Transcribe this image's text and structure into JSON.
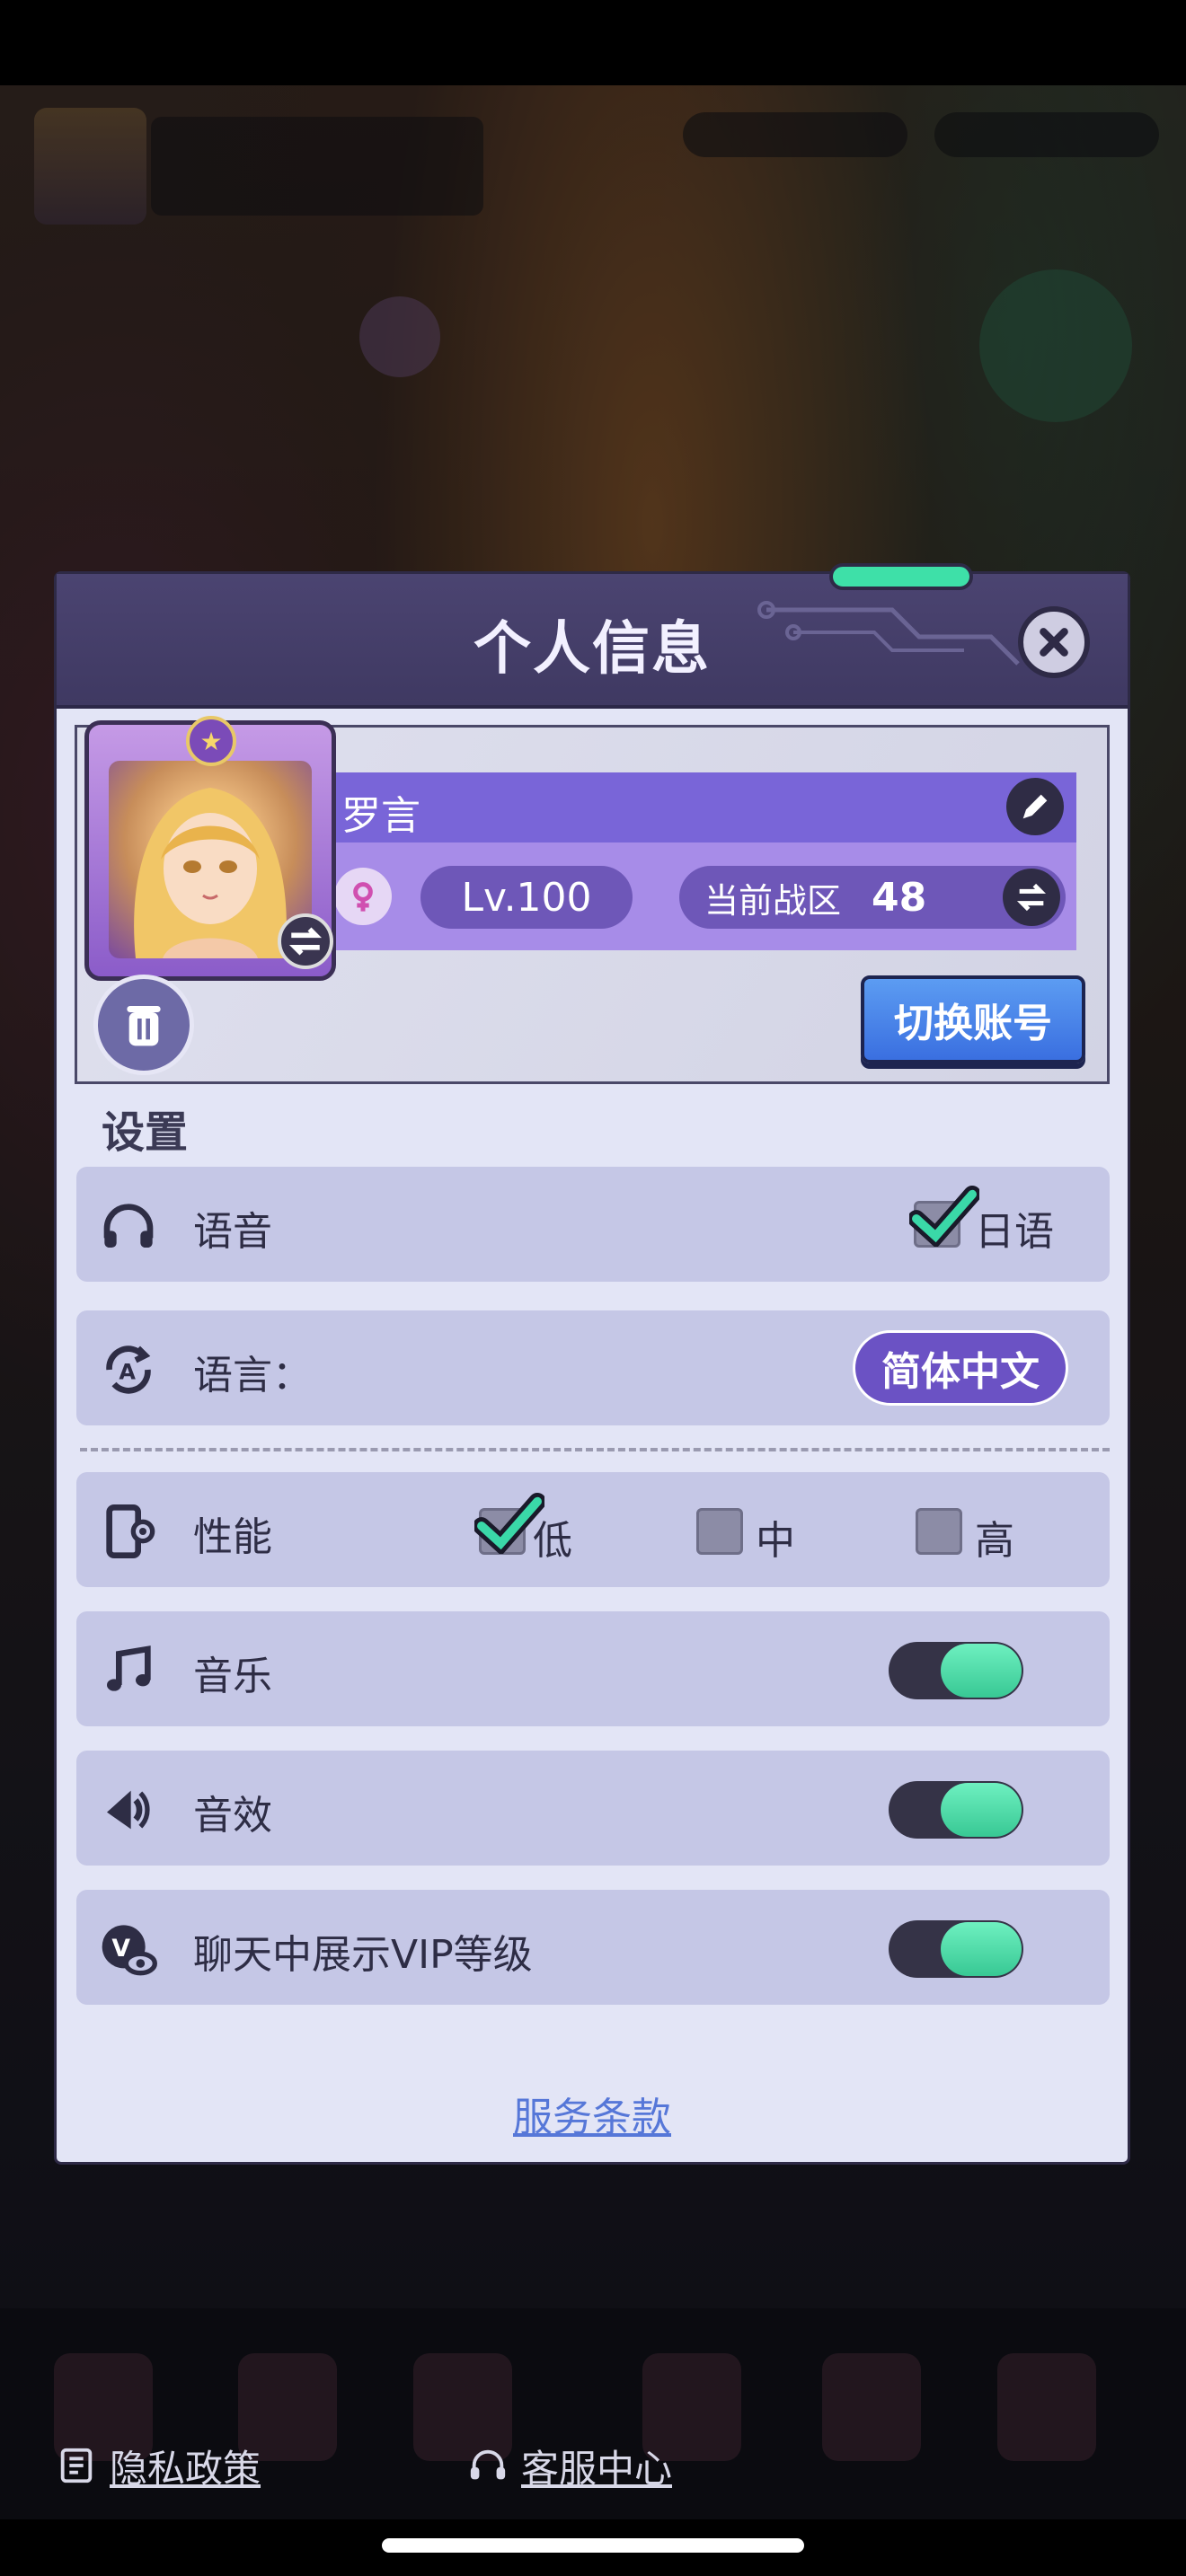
{
  "dialog": {
    "title": "个人信息"
  },
  "profile": {
    "name": "罗言",
    "level": "Lv.100",
    "zone_label": "当前战区",
    "zone_value": "48",
    "switch_account": "切换账号"
  },
  "settings": {
    "section_title": "设置",
    "voice": {
      "label": "语音",
      "option": "日语",
      "checked": true
    },
    "language": {
      "label": "语言：",
      "value": "简体中文"
    },
    "performance": {
      "label": "性能",
      "options": [
        {
          "label": "低",
          "checked": true
        },
        {
          "label": "中",
          "checked": false
        },
        {
          "label": "高",
          "checked": false
        }
      ]
    },
    "music": {
      "label": "音乐",
      "on": true
    },
    "sound_effects": {
      "label": "音效",
      "on": true
    },
    "vip_display": {
      "label": "聊天中展示VIP等级",
      "on": true
    }
  },
  "terms_link": "服务条款",
  "footer": {
    "privacy": "隐私政策",
    "support": "客服中心"
  },
  "colors": {
    "header": "#443e68",
    "panel": "#e3e5f6",
    "row": "#c5c7e6",
    "accent": "#6b52c4",
    "toggle_on": "#4bd8a6",
    "button_blue": "#4a82ea"
  }
}
